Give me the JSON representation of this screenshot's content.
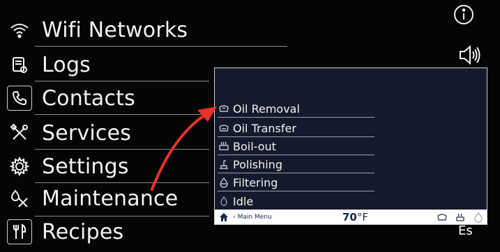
{
  "main_menu": {
    "items": [
      {
        "label": "Wifi Networks",
        "icon": "wifi-icon"
      },
      {
        "label": "Logs",
        "icon": "logs-icon"
      },
      {
        "label": "Contacts",
        "icon": "phone-icon"
      },
      {
        "label": "Services",
        "icon": "tools-icon"
      },
      {
        "label": "Settings",
        "icon": "gear-icon"
      },
      {
        "label": "Maintenance",
        "icon": "maintenance-icon"
      },
      {
        "label": "Recipes",
        "icon": "recipes-icon"
      }
    ]
  },
  "top_right": {
    "info_icon": "info-icon",
    "sound_icon": "speaker-icon"
  },
  "submenu": {
    "items": [
      {
        "label": "Oil Removal",
        "icon": "oil-removal-icon"
      },
      {
        "label": "Oil Transfer",
        "icon": "oil-transfer-icon"
      },
      {
        "label": "Boil-out",
        "icon": "boil-out-icon"
      },
      {
        "label": "Polishing",
        "icon": "polishing-icon"
      },
      {
        "label": "Filtering",
        "icon": "filtering-icon"
      },
      {
        "label": "Idle",
        "icon": "idle-icon"
      }
    ],
    "footer": {
      "back_label": "Main Menu",
      "temperature": "70",
      "unit": "°F",
      "status_icons": [
        "oil-status-icon",
        "fryer-status-icon",
        "filter-status-icon"
      ]
    }
  },
  "language_label": "Es",
  "colors": {
    "background": "#050505",
    "inset_background": "#141a2b",
    "arrow": "#e8322a",
    "text": "#f2f2f2"
  }
}
